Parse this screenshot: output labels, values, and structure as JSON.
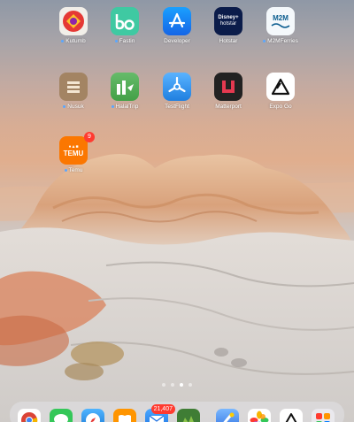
{
  "home": {
    "apps": [
      {
        "name": "Kutumb",
        "dot": true,
        "icon": "kutumb-icon",
        "color": "#f2efe9"
      },
      {
        "name": "Fastin",
        "dot": true,
        "icon": "fastin-icon",
        "color": "#3fc9a2"
      },
      {
        "name": "Developer",
        "dot": false,
        "icon": "developer-icon",
        "color": "#1a7cf5"
      },
      {
        "name": "Hotstar",
        "dot": false,
        "icon": "hotstar-icon",
        "color": "#0b1c4a"
      },
      {
        "name": "M2MFerries",
        "dot": true,
        "icon": "m2m-ferries-icon",
        "color": "#f4f8fb"
      },
      {
        "name": "Nusuk",
        "dot": true,
        "icon": "nusuk-icon",
        "color": "#a38463"
      },
      {
        "name": "HalalTrip",
        "dot": true,
        "icon": "halaltrip-icon",
        "color": "#4caf50"
      },
      {
        "name": "TestFlight",
        "dot": false,
        "icon": "testflight-icon",
        "color": "#3a9cf5"
      },
      {
        "name": "Matterport",
        "dot": false,
        "icon": "matterport-icon",
        "color": "#222222"
      },
      {
        "name": "Expo Go",
        "dot": false,
        "icon": "expo-go-icon",
        "color": "#ffffff"
      },
      {
        "name": "Temu",
        "dot": true,
        "icon": "temu-icon",
        "color": "#fb7701",
        "badge": "9",
        "icon_text": "TEMU"
      }
    ],
    "hotstar_icon_text": [
      "Disney+",
      "hotstar"
    ],
    "m2m_icon_text": "M2M",
    "pages": 4,
    "current_page": 3
  },
  "dock": {
    "apps": [
      {
        "icon": "chrome-icon",
        "color": "#ffffff"
      },
      {
        "icon": "messages-icon",
        "color": "#35c759"
      },
      {
        "icon": "safari-icon",
        "color": "#1e88e5"
      },
      {
        "icon": "books-icon",
        "color": "#ff9500"
      },
      {
        "icon": "mail-icon",
        "color": "#2f8cf6",
        "badge": "21,407"
      },
      {
        "icon": "folder-app-icon",
        "color": "#3f7d35"
      },
      {
        "icon": "xcode-icon",
        "color": "#3b82f6"
      },
      {
        "icon": "photos-icon",
        "color": "#ffffff"
      },
      {
        "icon": "expo-dock-icon",
        "color": "#ffffff"
      },
      {
        "icon": "app-library-icon",
        "color": "#e5e5ea"
      }
    ]
  }
}
